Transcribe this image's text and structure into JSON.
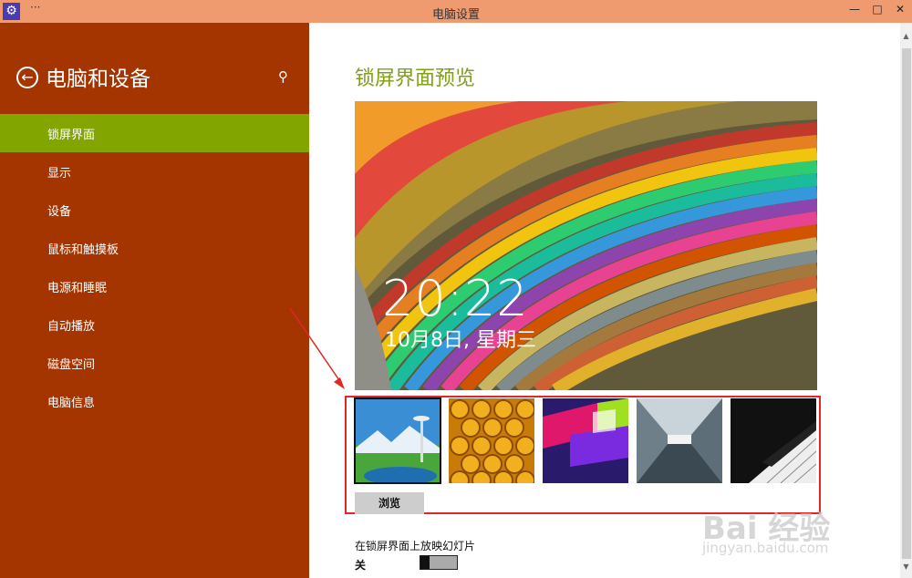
{
  "window": {
    "title": "电脑设置",
    "app_icon": "gear-icon",
    "menu_dots": "···",
    "minimize": "—",
    "maximize": "□",
    "close": "✕"
  },
  "sidebar": {
    "heading": "电脑和设备",
    "back_icon": "back-arrow-circle-icon",
    "search_icon": "search-icon",
    "items": [
      {
        "label": "锁屏界面",
        "active": true
      },
      {
        "label": "显示"
      },
      {
        "label": "设备"
      },
      {
        "label": "鼠标和触摸板"
      },
      {
        "label": "电源和睡眠"
      },
      {
        "label": "自动播放"
      },
      {
        "label": "磁盘空间"
      },
      {
        "label": "电脑信息"
      }
    ]
  },
  "main": {
    "title": "锁屏界面预览",
    "preview": {
      "time": "20:22",
      "date": "10月8日, 星期三"
    },
    "thumbnails": [
      "space-needle",
      "honeycomb",
      "geometric",
      "tunnel",
      "piano"
    ],
    "browse_label": "浏览",
    "slideshow_label": "在锁屏界面上放映幻灯片",
    "slideshow_state": "关"
  },
  "watermark": {
    "text": "Bai 经验",
    "sub": "jingyan.baidu.com"
  },
  "colors": {
    "titlebar": "#F09A6F",
    "sidebar": "#A43400",
    "active_item": "#83A500",
    "title_green": "#7FA017",
    "annotation": "#E0272A"
  }
}
